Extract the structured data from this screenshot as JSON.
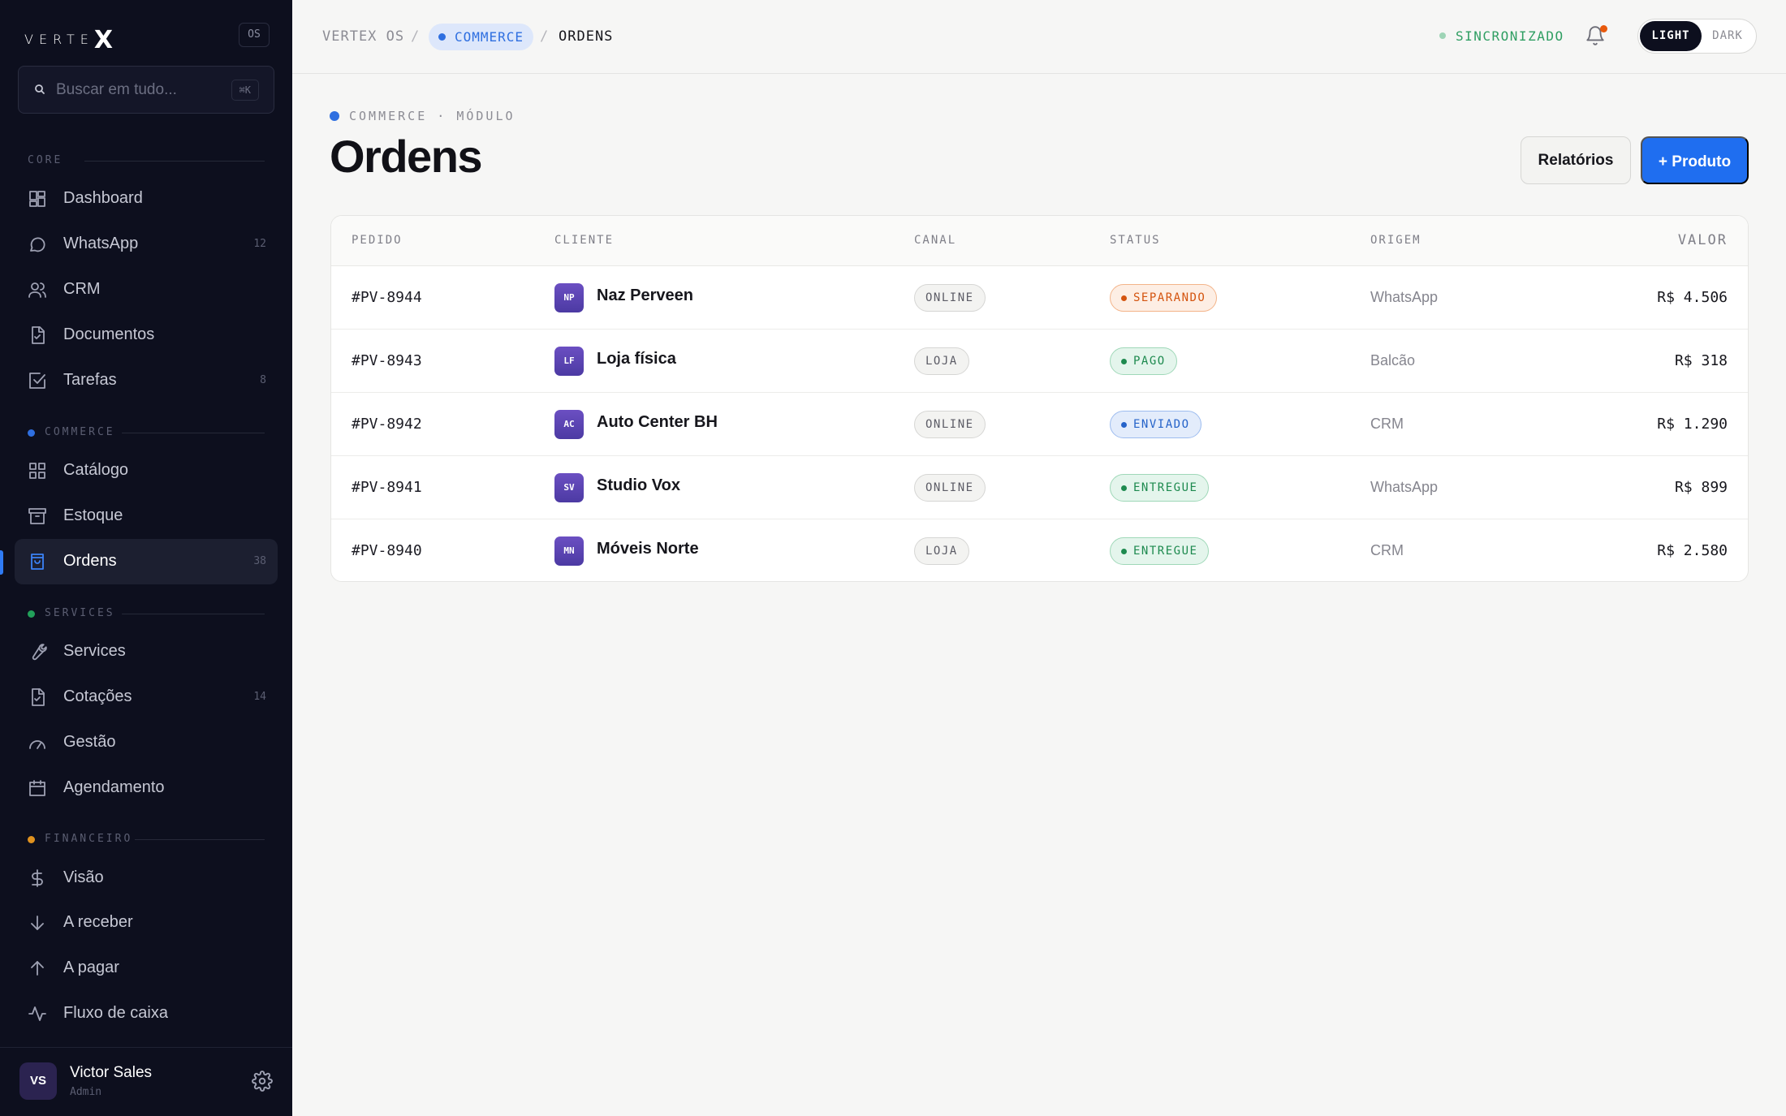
{
  "brand": {
    "logo_text": "VERTE",
    "logo_mark": "X",
    "os_badge": "OS"
  },
  "search": {
    "placeholder": "Buscar em tudo...",
    "shortcut": "⌘K"
  },
  "sidebar": {
    "sections": {
      "core": "CORE",
      "commerce": "COMMERCE",
      "services": "SERVICES",
      "financeiro": "FINANCEIRO"
    },
    "section_colors": {
      "commerce": "#2f6fe0",
      "services": "#22a05a",
      "financeiro": "#e0921f"
    },
    "items": [
      {
        "label": "Dashboard",
        "icon": "dashboard-icon",
        "count": ""
      },
      {
        "label": "WhatsApp",
        "icon": "chat-bubble-icon",
        "count": "12"
      },
      {
        "label": "CRM",
        "icon": "users-icon",
        "count": ""
      },
      {
        "label": "Documentos",
        "icon": "document-check-icon",
        "count": ""
      },
      {
        "label": "Tarefas",
        "icon": "checkbox-icon",
        "count": "8"
      },
      {
        "label": "Catálogo",
        "icon": "grid-icon",
        "count": ""
      },
      {
        "label": "Estoque",
        "icon": "archive-box-icon",
        "count": ""
      },
      {
        "label": "Ordens",
        "icon": "shopping-bag-icon",
        "count": "38",
        "active": true
      },
      {
        "label": "Services",
        "icon": "wrench-icon",
        "count": ""
      },
      {
        "label": "Cotações",
        "icon": "document-check-icon",
        "count": "14"
      },
      {
        "label": "Gestão",
        "icon": "gauge-icon",
        "count": ""
      },
      {
        "label": "Agendamento",
        "icon": "calendar-icon",
        "count": ""
      },
      {
        "label": "Visão",
        "icon": "dollar-icon",
        "count": ""
      },
      {
        "label": "A receber",
        "icon": "arrow-down-icon",
        "count": ""
      },
      {
        "label": "A pagar",
        "icon": "arrow-up-icon",
        "count": ""
      },
      {
        "label": "Fluxo de caixa",
        "icon": "activity-icon",
        "count": ""
      }
    ],
    "user": {
      "initials": "VS",
      "name": "Victor Sales",
      "role": "Admin"
    }
  },
  "topbar": {
    "breadcrumb": [
      "VERTEX OS",
      "COMMERCE",
      "ORDENS"
    ],
    "separator": "/",
    "sync_status": "SINCRONIZADO",
    "theme": {
      "light": "LIGHT",
      "dark": "DARK",
      "selected": "LIGHT"
    }
  },
  "page": {
    "eyebrow": "COMMERCE · MÓDULO",
    "title": "Ordens",
    "secondary_button": "Relatórios",
    "primary_button": "+ Produto"
  },
  "table": {
    "columns": [
      "PEDIDO",
      "CLIENTE",
      "CANAL",
      "STATUS",
      "ORIGEM",
      "VALOR"
    ],
    "rows": [
      {
        "id": "#PV-8944",
        "initials": "NP",
        "client": "Naz Perveen",
        "canal": "ONLINE",
        "status": "SEPARANDO",
        "status_key": "separando",
        "origem": "WhatsApp",
        "valor": "R$ 4.506"
      },
      {
        "id": "#PV-8943",
        "initials": "LF",
        "client": "Loja física",
        "canal": "LOJA",
        "status": "PAGO",
        "status_key": "pago",
        "origem": "Balcão",
        "valor": "R$ 318"
      },
      {
        "id": "#PV-8942",
        "initials": "AC",
        "client": "Auto Center BH",
        "canal": "ONLINE",
        "status": "ENVIADO",
        "status_key": "enviado",
        "origem": "CRM",
        "valor": "R$ 1.290"
      },
      {
        "id": "#PV-8941",
        "initials": "SV",
        "client": "Studio Vox",
        "canal": "ONLINE",
        "status": "ENTREGUE",
        "status_key": "entregue",
        "origem": "WhatsApp",
        "valor": "R$ 899"
      },
      {
        "id": "#PV-8940",
        "initials": "MN",
        "client": "Móveis Norte",
        "canal": "LOJA",
        "status": "ENTREGUE",
        "status_key": "entregue",
        "origem": "CRM",
        "valor": "R$ 2.580"
      }
    ]
  }
}
